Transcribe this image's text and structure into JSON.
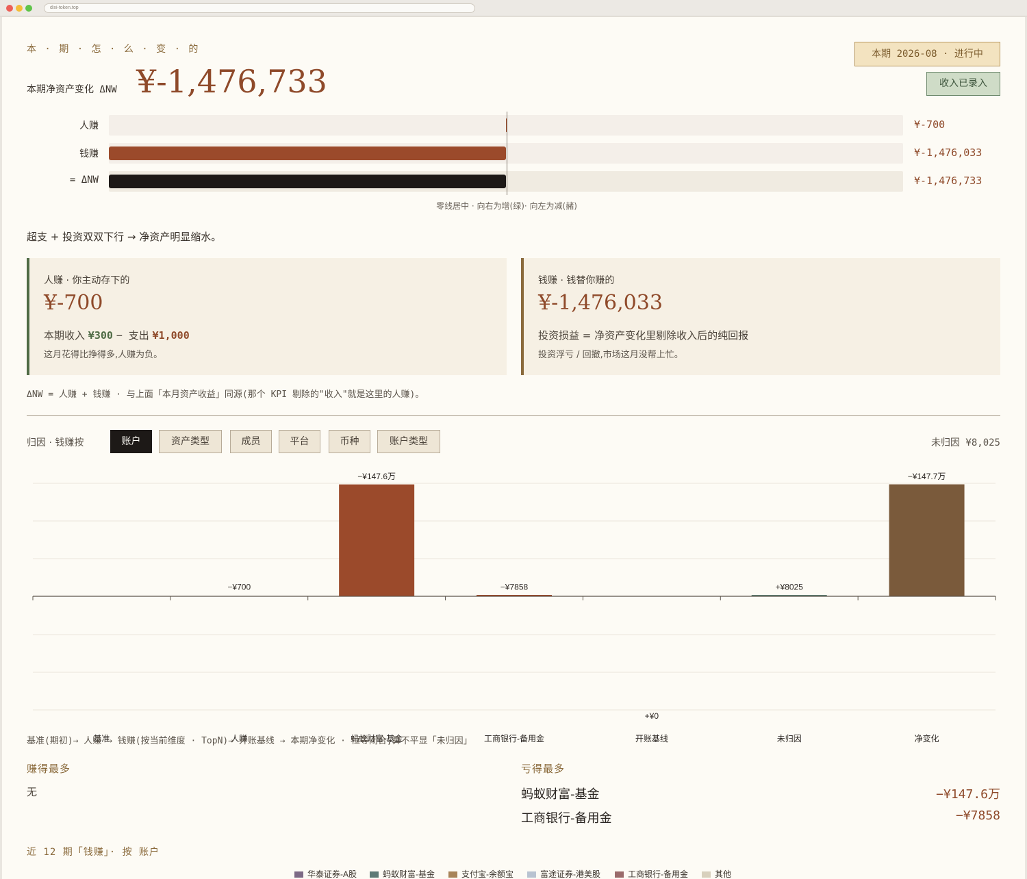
{
  "browser": {
    "url": "dixi-token.top"
  },
  "header": {
    "kicker": "本 · 期 · 怎 · 么 · 变 · 的",
    "nw_label": "本期净资产变化 ΔNW",
    "nw_value": "¥-1,476,733",
    "period_badge": "本期 2026-08 · 进行中",
    "income_button": "收入已录入"
  },
  "bars": {
    "rows": [
      {
        "label": "人赚",
        "value_text": "¥-700",
        "value": -700
      },
      {
        "label": "钱赚",
        "value_text": "¥-1,476,033",
        "value": -1476033
      },
      {
        "label": "= ΔNW",
        "value_text": "¥-1,476,733",
        "value": -1476733
      }
    ],
    "caption": "零线居中 · 向右为增(绿)· 向左为减(赭)"
  },
  "summary": "超支 + 投资双双下行 → 净资产明显缩水。",
  "cards": {
    "human": {
      "title": "人赚 · 你主动存下的",
      "value": "¥-700",
      "line_prefix": "本期收入",
      "income": "¥300",
      "line_mid": "− 支出",
      "expense": "¥1,000",
      "note": "这月花得比挣得多,人赚为负。"
    },
    "money": {
      "title": "钱赚 · 钱替你赚的",
      "value": "¥-1,476,033",
      "line": "投资损益 = 净资产变化里剔除收入后的纯回报",
      "note": "投资浮亏 / 回撤,市场这月没帮上忙。"
    }
  },
  "formula_note": "ΔNW = 人赚 + 钱赚 · 与上面「本月资产收益」同源(那个 KPI 剔除的\"收入\"就是这里的人赚)。",
  "attribution": {
    "label": "归因 · 钱赚按",
    "tabs": [
      "账户",
      "资产类型",
      "成员",
      "平台",
      "币种",
      "账户类型"
    ],
    "active_tab": "账户",
    "unattributed": "未归因 ¥8,025"
  },
  "chart_data": {
    "type": "bar",
    "subtype": "waterfall",
    "categories": [
      "基准",
      "人赚",
      "蚂蚁财富-基金",
      "工商银行-备用金",
      "开账基线",
      "未归因",
      "净变化"
    ],
    "values": [
      0,
      -700,
      -1476000,
      -7858,
      0,
      8025,
      -1477000
    ],
    "data_labels": [
      "",
      "−¥700",
      "−¥147.6万",
      "−¥7858",
      "+¥0",
      "+¥8025",
      "−¥147.7万"
    ],
    "colors": {
      "negative": "#9b4a2b",
      "positive": "#5e7a6e",
      "total": "#7a5a3b"
    },
    "grid": true
  },
  "chart_caption": "基准(期初)→ 人赚 → 钱赚(按当前维度 · TopN)→ 开账基线 → 本期净变化 · 恒等闭合,算不平显「未归因」",
  "top_earn": {
    "title": "赚得最多",
    "empty": "无"
  },
  "top_loss": {
    "title": "亏得最多",
    "items": [
      {
        "name": "蚂蚁财富-基金",
        "value": "−¥147.6万"
      },
      {
        "name": "工商银行-备用金",
        "value": "−¥7858"
      }
    ]
  },
  "history": {
    "title": "近 12 期「钱赚」· 按 账户",
    "legend": [
      {
        "name": "华泰证券-A股",
        "color": "#7d6a85"
      },
      {
        "name": "蚂蚁财富-基金",
        "color": "#5e7a76"
      },
      {
        "name": "支付宝-余额宝",
        "color": "#a88459"
      },
      {
        "name": "富途证券-港美股",
        "color": "#b9c3d1"
      },
      {
        "name": "工商银行-备用金",
        "color": "#9a6b6b"
      },
      {
        "name": "其他",
        "color": "#d8d0bd"
      }
    ]
  }
}
